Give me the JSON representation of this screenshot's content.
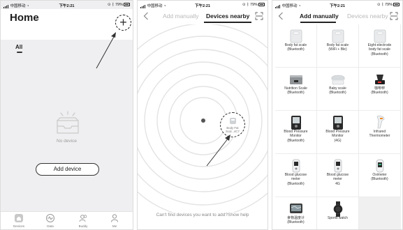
{
  "status_bar": {
    "carrier": "中国移动",
    "time": "下午2:21",
    "battery": "79%"
  },
  "home": {
    "title": "Home",
    "tabs": [
      {
        "label": "All"
      }
    ],
    "empty_state": "No device",
    "add_device_button": "Add device",
    "bottom_tabs": [
      {
        "label": "Devices",
        "icon": "house-icon"
      },
      {
        "label": "Data",
        "icon": "pulse-icon"
      },
      {
        "label": "Buddy",
        "icon": "people-icon"
      },
      {
        "label": "Me",
        "icon": "person-icon"
      }
    ]
  },
  "nearby": {
    "tabs": [
      {
        "label": "Add manually",
        "active": false
      },
      {
        "label": "Devices nearby",
        "active": true
      }
    ],
    "found_device": {
      "label": "Body Fat Scal...4C7"
    },
    "help_text": "Can't find devices you want to add?Show help"
  },
  "manual": {
    "tabs": [
      {
        "label": "Add manually",
        "active": true
      },
      {
        "label": "Devices nearby",
        "active": false
      }
    ],
    "devices": [
      {
        "name": "Body fat scale\n(Bluetooth)",
        "icon": "scale-icon"
      },
      {
        "name": "Body fat scale\n(WiFi + Ble)",
        "icon": "scale-icon"
      },
      {
        "name": "Eight-electrode\nbody fat scale\n(Bluetooth)",
        "icon": "scale-icon"
      },
      {
        "name": "Nutrition Scale\n(Bluetooth)",
        "icon": "nutrition-scale-icon"
      },
      {
        "name": "Baby scale\n(Bluetooth)",
        "icon": "baby-scale-icon"
      },
      {
        "name": "咖啡秤\n(Bluetooth)",
        "icon": "coffee-scale-icon"
      },
      {
        "name": "Blood Pressure\nMonitor\n(Bluetooth)",
        "icon": "blood-pressure-icon"
      },
      {
        "name": "Blood Pressure\nMonitor\n(4G)",
        "icon": "blood-pressure-icon"
      },
      {
        "name": "Infrared\nThermometer",
        "icon": "thermometer-icon"
      },
      {
        "name": "Blood glucose\nmeter\n(Bluetooth)",
        "icon": "glucose-meter-icon"
      },
      {
        "name": "Blood glucose\nmeter\n4G",
        "icon": "glucose-meter-icon"
      },
      {
        "name": "Oximeter\n(Bluetooth)",
        "icon": "oximeter-icon"
      },
      {
        "name": "食物温度计\n(Bluetooth)",
        "icon": "food-thermometer-icon"
      },
      {
        "name": "Sports watch",
        "icon": "watch-icon"
      }
    ]
  }
}
